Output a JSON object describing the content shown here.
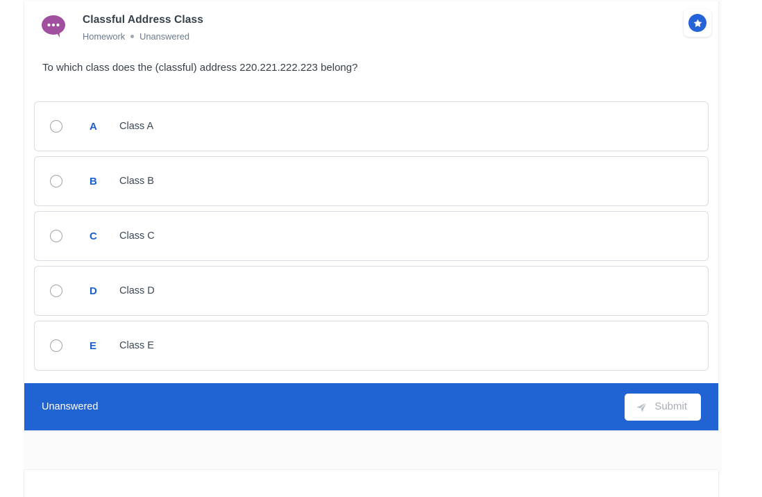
{
  "question_card": {
    "icon": "speech-bubble-icon",
    "title": "Classful Address Class",
    "meta": {
      "category": "Homework",
      "separator": "•",
      "status": "Unanswered"
    },
    "star_badge": {
      "icon": "star-icon",
      "circle_color": "#2563d9"
    },
    "prompt": "To which class does the (classful) address 220.221.222.223 belong?",
    "options": [
      {
        "letter": "A",
        "text": "Class A",
        "selected": false
      },
      {
        "letter": "B",
        "text": "Class B",
        "selected": false
      },
      {
        "letter": "C",
        "text": "Class C",
        "selected": false
      },
      {
        "letter": "D",
        "text": "Class D",
        "selected": false
      },
      {
        "letter": "E",
        "text": "Class E",
        "selected": false
      }
    ],
    "footer": {
      "status": "Unanswered",
      "submit_label": "Submit",
      "submit_icon": "send-icon",
      "submit_disabled": true,
      "background_color": "#2263d4"
    }
  },
  "colors": {
    "accent_blue": "#2263d4",
    "letter_blue": "#1a5fd0",
    "bubble_purple": "#a0509f",
    "text_dark": "#36404a",
    "text_muted": "#6c7a89"
  }
}
